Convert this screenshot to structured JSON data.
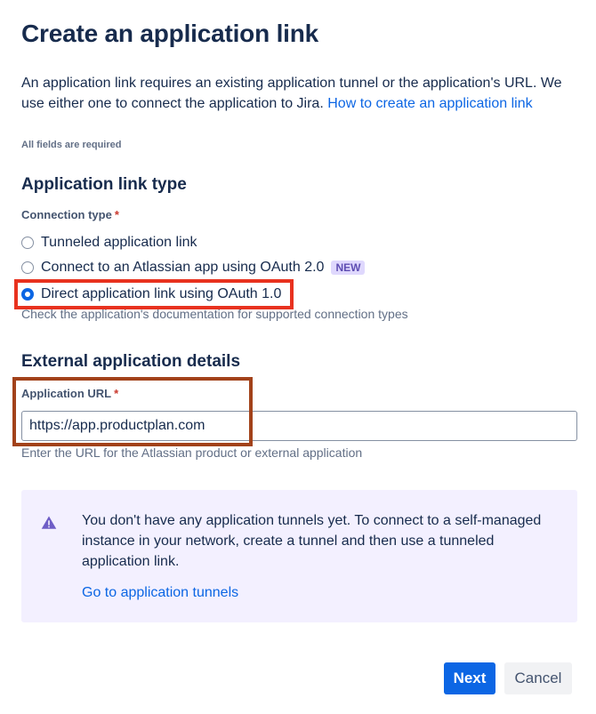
{
  "header": {
    "title": "Create an application link"
  },
  "intro": {
    "text": "An application link requires an existing application tunnel or the application's URL. We use either one to connect the application to Jira.",
    "link_label": "How to create an application link"
  },
  "required_note": "All fields are required",
  "link_type_section": {
    "title": "Application link type",
    "connection_label": "Connection type",
    "required_mark": "*",
    "options": [
      {
        "label": "Tunneled application link",
        "checked": false
      },
      {
        "label": "Connect to an Atlassian app using OAuth 2.0",
        "checked": false,
        "badge": "NEW"
      },
      {
        "label": "Direct application link using OAuth 1.0",
        "checked": true
      }
    ],
    "helper": "Check the application's documentation for supported connection types"
  },
  "details_section": {
    "title": "External application details",
    "url_label": "Application URL",
    "required_mark": "*",
    "url_value": "https://app.productplan.com",
    "helper": "Enter the URL for the Atlassian product or external application"
  },
  "info_panel": {
    "icon": "warning-icon",
    "message": "You don't have any application tunnels yet. To connect to a self-managed instance in your network, create a tunnel and then use a tunneled application link.",
    "link_label": "Go to application tunnels"
  },
  "footer": {
    "next_label": "Next",
    "cancel_label": "Cancel"
  },
  "colors": {
    "primary": "#0c66e4",
    "text": "#172b4d",
    "subtle": "#626f86",
    "info_bg": "#f3f0ff",
    "badge_bg": "#dfd8fd",
    "badge_text": "#5e4db2",
    "highlight_red": "#e8321f",
    "highlight_brown": "#a2421a"
  }
}
